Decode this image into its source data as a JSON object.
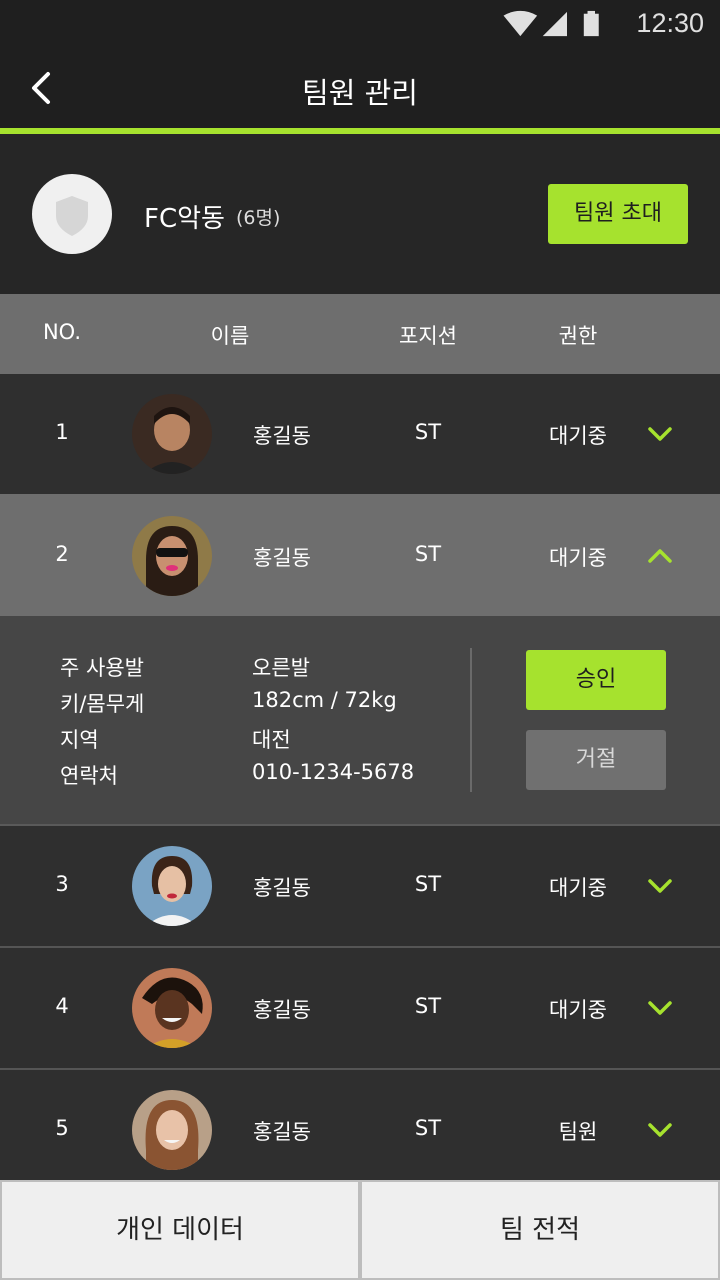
{
  "status_bar": {
    "time": "12:30"
  },
  "app_bar": {
    "title": "팀원 관리"
  },
  "team": {
    "name": "FC악동",
    "count": "(6명)",
    "invite_label": "팀원 초대"
  },
  "table": {
    "headers": {
      "no": "NO.",
      "name": "이름",
      "position": "포지션",
      "role": "권한"
    },
    "rows": [
      {
        "no": "1",
        "name": "홍길동",
        "position": "ST",
        "role": "대기중",
        "expanded": false
      },
      {
        "no": "2",
        "name": "홍길동",
        "position": "ST",
        "role": "대기중",
        "expanded": true
      },
      {
        "no": "3",
        "name": "홍길동",
        "position": "ST",
        "role": "대기중",
        "expanded": false
      },
      {
        "no": "4",
        "name": "홍길동",
        "position": "ST",
        "role": "대기중",
        "expanded": false
      },
      {
        "no": "5",
        "name": "홍길동",
        "position": "ST",
        "role": "팀원",
        "expanded": false
      }
    ]
  },
  "detail": {
    "foot_label": "주 사용발",
    "foot_value": "오른발",
    "body_label": "키/몸무게",
    "body_value": "182cm / 72kg",
    "region_label": "지역",
    "region_value": "대전",
    "contact_label": "연락처",
    "contact_value": "010-1234-5678",
    "approve_label": "승인",
    "reject_label": "거절"
  },
  "bottom_nav": {
    "personal_label": "개인 데이터",
    "team_label": "팀 전적"
  },
  "colors": {
    "accent": "#a6e22e",
    "background": "#262626",
    "header_bar": "#6e6e6e"
  }
}
